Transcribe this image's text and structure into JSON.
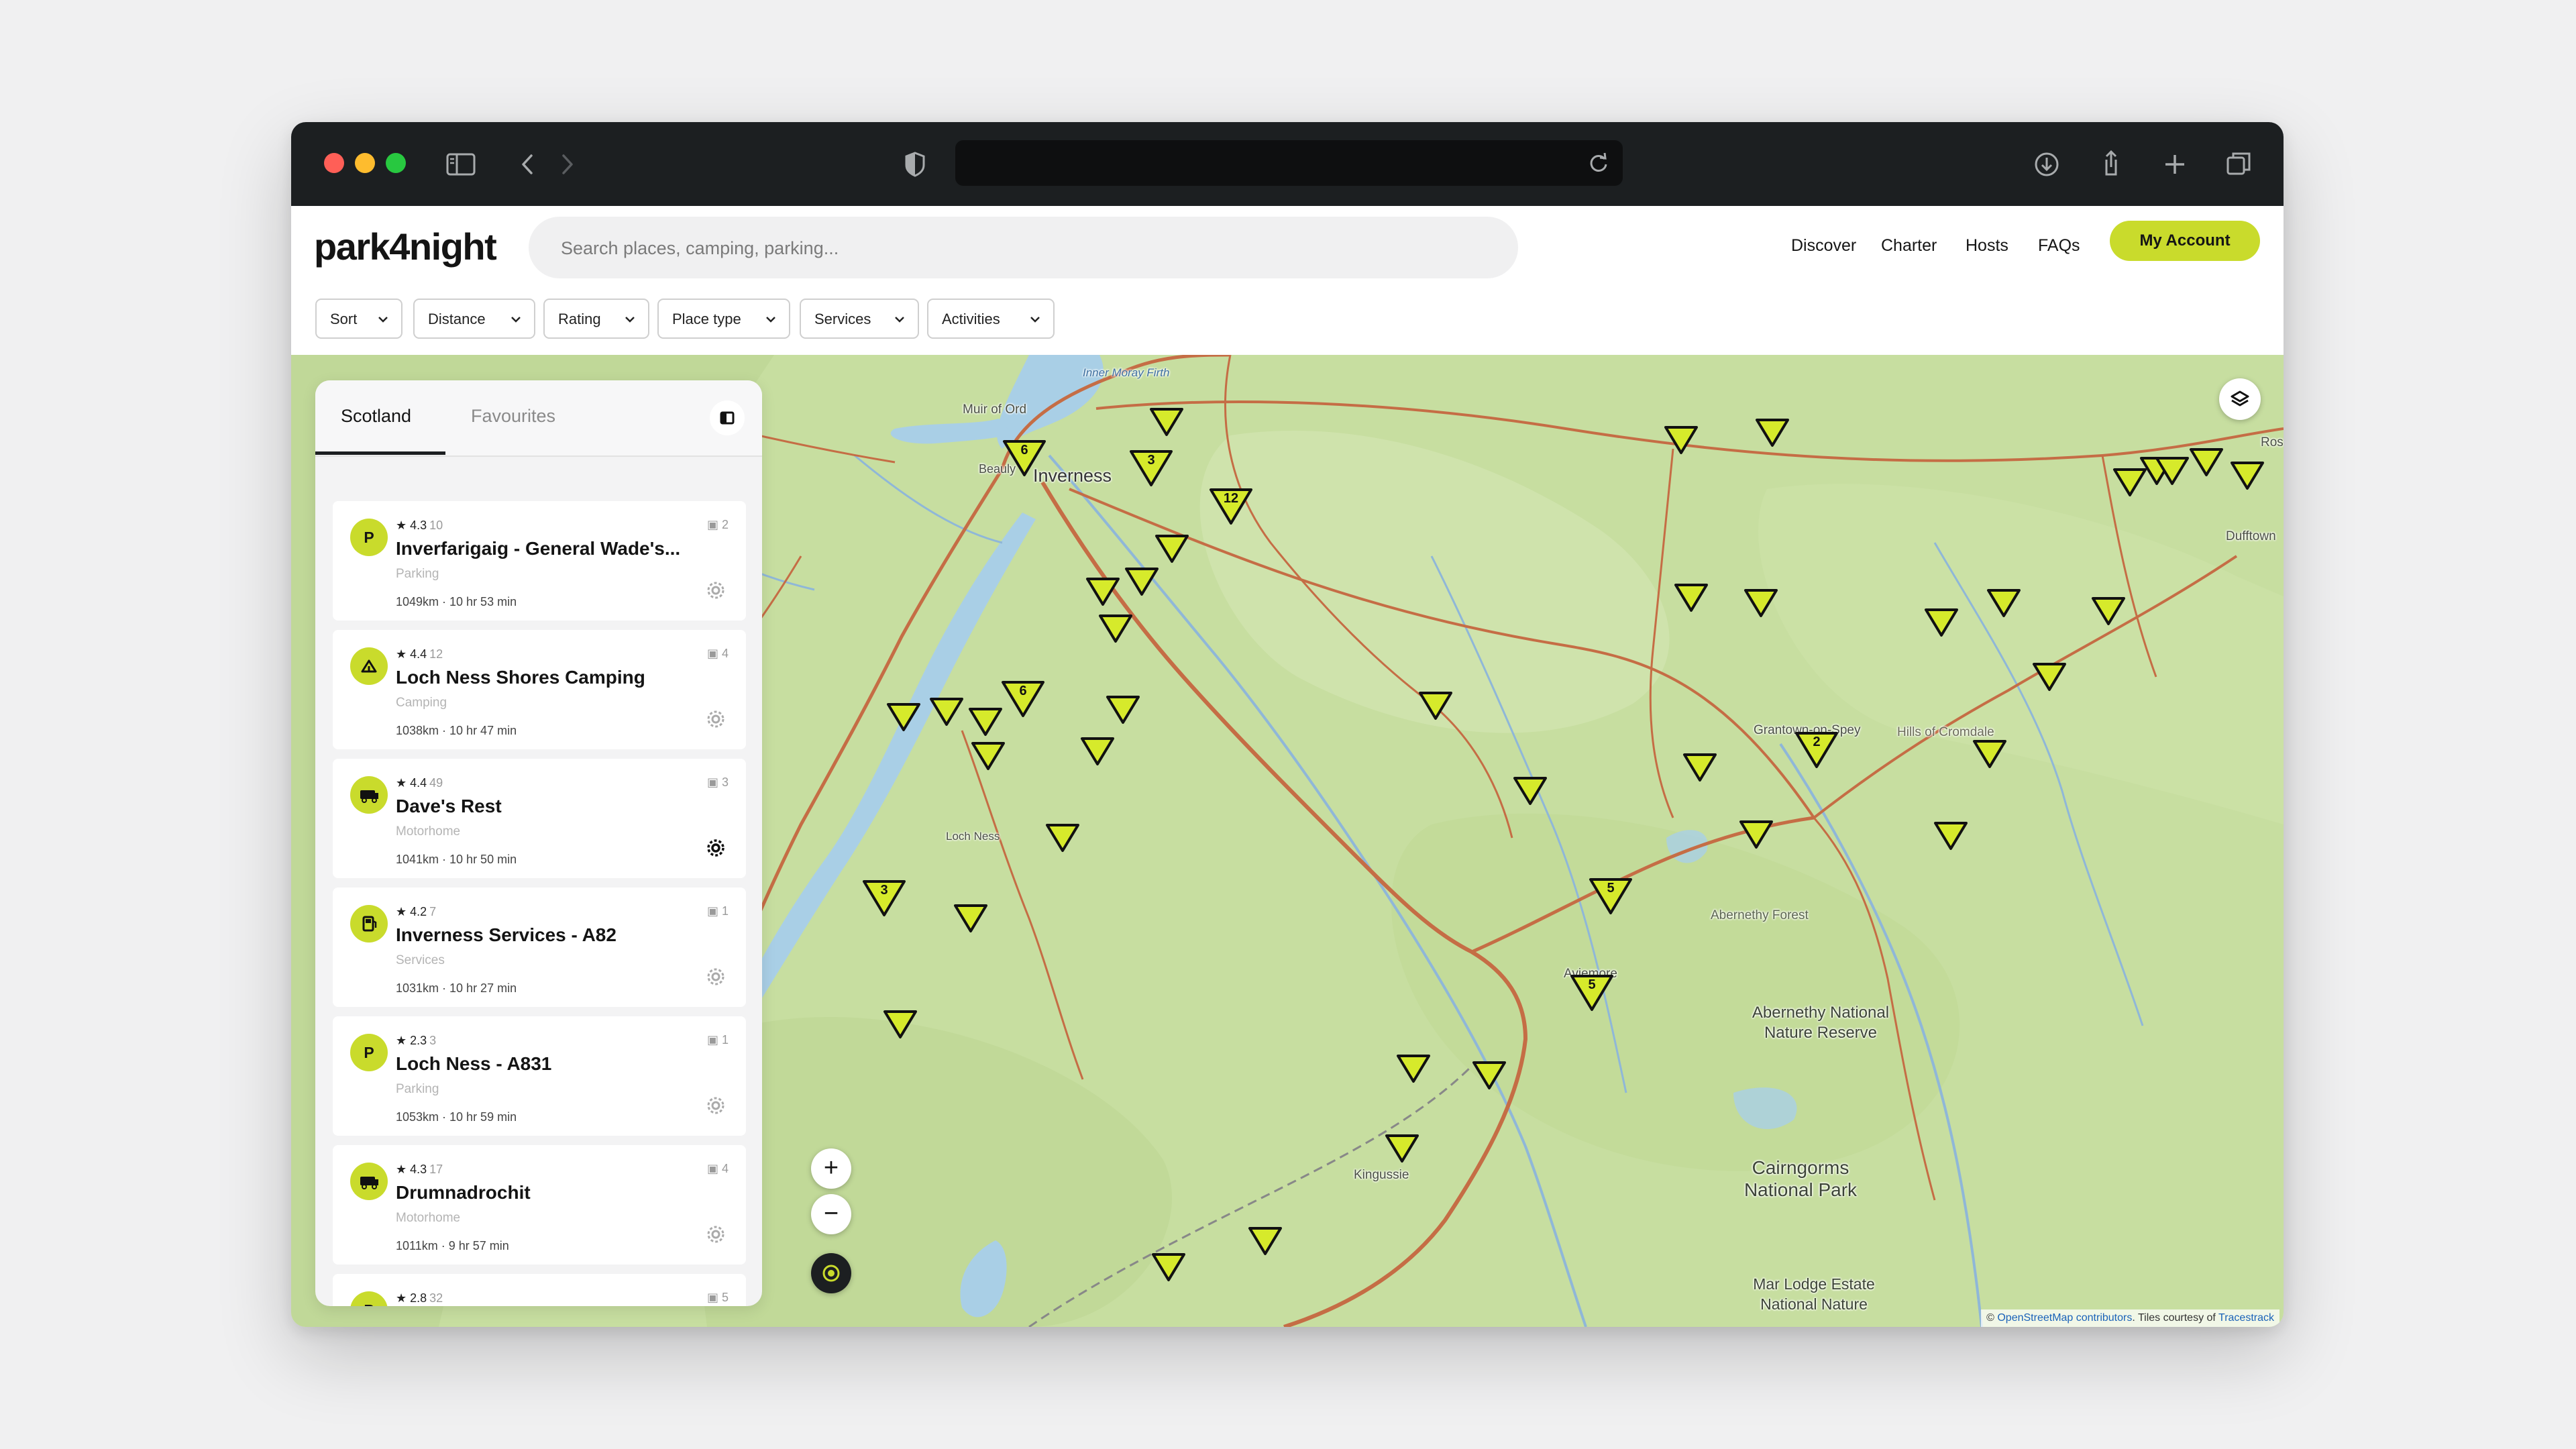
{
  "brand": {
    "logo": "park4night",
    "accent": "#c9db2c"
  },
  "search": {
    "placeholder": "Search places, camping, parking..."
  },
  "nav": {
    "discover": "Discover",
    "charter": "Charter",
    "hosts": "Hosts",
    "faqs": "FAQs",
    "account": "My Account"
  },
  "filters": {
    "sort": "Sort",
    "distance": "Distance",
    "rating": "Rating",
    "place_type": "Place type",
    "services": "Services",
    "activities": "Activities"
  },
  "panel": {
    "tabs": {
      "active": "Scotland",
      "inactive": "Favourites"
    },
    "places": [
      {
        "icon": "P",
        "rating": "4.3",
        "reviews": "10",
        "photos": "2",
        "name": "Inverfarigaig - General Wade's...",
        "type": "Parking",
        "distance": "1049km · 10 hr 53 min"
      },
      {
        "icon": "camping-tent-icon",
        "rating": "4.4",
        "reviews": "12",
        "photos": "4",
        "name": "Loch Ness Shores Camping",
        "type": "Camping",
        "distance": "1038km · 10 hr 47 min"
      },
      {
        "icon": "motorhome-icon",
        "rating": "4.4",
        "reviews": "49",
        "photos": "3",
        "name": "Dave's Rest",
        "type": "Motorhome",
        "distance": "1041km · 10 hr 50 min"
      },
      {
        "icon": "services-icon",
        "rating": "4.2",
        "reviews": "7",
        "photos": "1",
        "name": "Inverness Services - A82",
        "type": "Services",
        "distance": "1031km · 10 hr 27 min"
      },
      {
        "icon": "P",
        "rating": "2.3",
        "reviews": "3",
        "photos": "1",
        "name": "Loch Ness - A831",
        "type": "Parking",
        "distance": "1053km · 10 hr 59 min"
      },
      {
        "icon": "motorhome-icon",
        "rating": "4.3",
        "reviews": "17",
        "photos": "4",
        "name": "Drumnadrochit",
        "type": "Motorhome",
        "distance": "1011km · 9 hr 57 min"
      },
      {
        "icon": "P",
        "rating": "2.8",
        "reviews": "32",
        "photos": "5"
      }
    ]
  },
  "map": {
    "labels": {
      "muir_of_ord": "Muir of Ord",
      "beauly": "Beauly",
      "inverness": "Inverness",
      "inner_moray_firth": "Inner Moray Firth",
      "loch_ness": "Loch Ness",
      "grantown": "Grantown-on-Spey",
      "hills_cromdale": "Hills of Cromdale",
      "abernethy_forest": "Abernethy Forest",
      "aviemore": "Aviemore",
      "abernethy_reserve": "Abernethy National Nature Reserve",
      "kingussie": "Kingussie",
      "cairngorms": "Cairngorms National Park",
      "mar_lodge": "Mar Lodge Estate National Nature",
      "dufftown": "Dufftown",
      "ros": "Ros"
    },
    "cluster_counts": {
      "beauly": "6",
      "inverness_west": "3",
      "inverness": "12",
      "loch_ness_mid": "6",
      "loch_ness_south": "3",
      "grantown": "2",
      "aviemore_north": "5",
      "aviemore": "5"
    },
    "zoom_in": "+",
    "zoom_out": "−",
    "attribution": {
      "prefix": "© ",
      "osm": "OpenStreetMap contributors",
      "mid": ". Tiles courtesy of ",
      "tiles": "Tracestrack"
    }
  }
}
